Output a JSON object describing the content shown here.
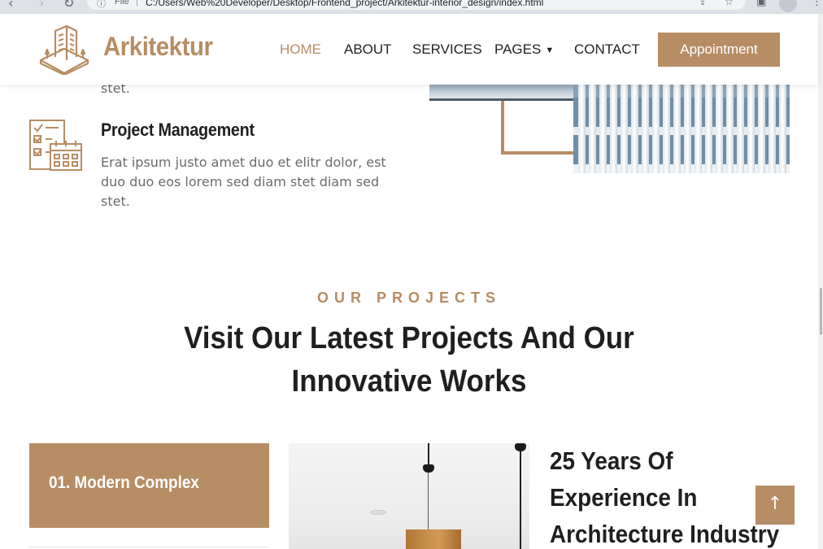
{
  "browser": {
    "file_label": "File",
    "separator": "|",
    "url": "C:/Users/Web%20Developer/Desktop/Frontend_project/Arkitektur-interior_design/index.html"
  },
  "brand": {
    "name": "Arkitektur"
  },
  "nav": {
    "items": [
      "HOME",
      "ABOUT",
      "SERVICES",
      "PAGES",
      "CONTACT"
    ],
    "active": "HOME",
    "cta": "Appointment"
  },
  "features": {
    "previous_tail": "stet.",
    "item": {
      "title": "Project Management",
      "desc_lines": [
        "Erat ipsum justo amet duo et elitr dolor, est",
        "duo duo eos lorem sed diam stet diam sed",
        "stet."
      ]
    }
  },
  "projects": {
    "kicker": "OUR PROJECTS",
    "title_lines": [
      "Visit Our Latest Projects And Our",
      "Innovative Works"
    ],
    "cards": [
      {
        "label": "01. Modern Complex"
      }
    ],
    "experience_lines": [
      "25 Years Of",
      "Experience In",
      "Architecture Industry"
    ]
  },
  "colors": {
    "accent": "#b78d65",
    "text_dark": "#1f1f1f",
    "text_muted": "#6b6b6b"
  },
  "icons": {
    "back_to_top": "arrow-up-icon",
    "nav_caret": "chevron-down-icon"
  }
}
